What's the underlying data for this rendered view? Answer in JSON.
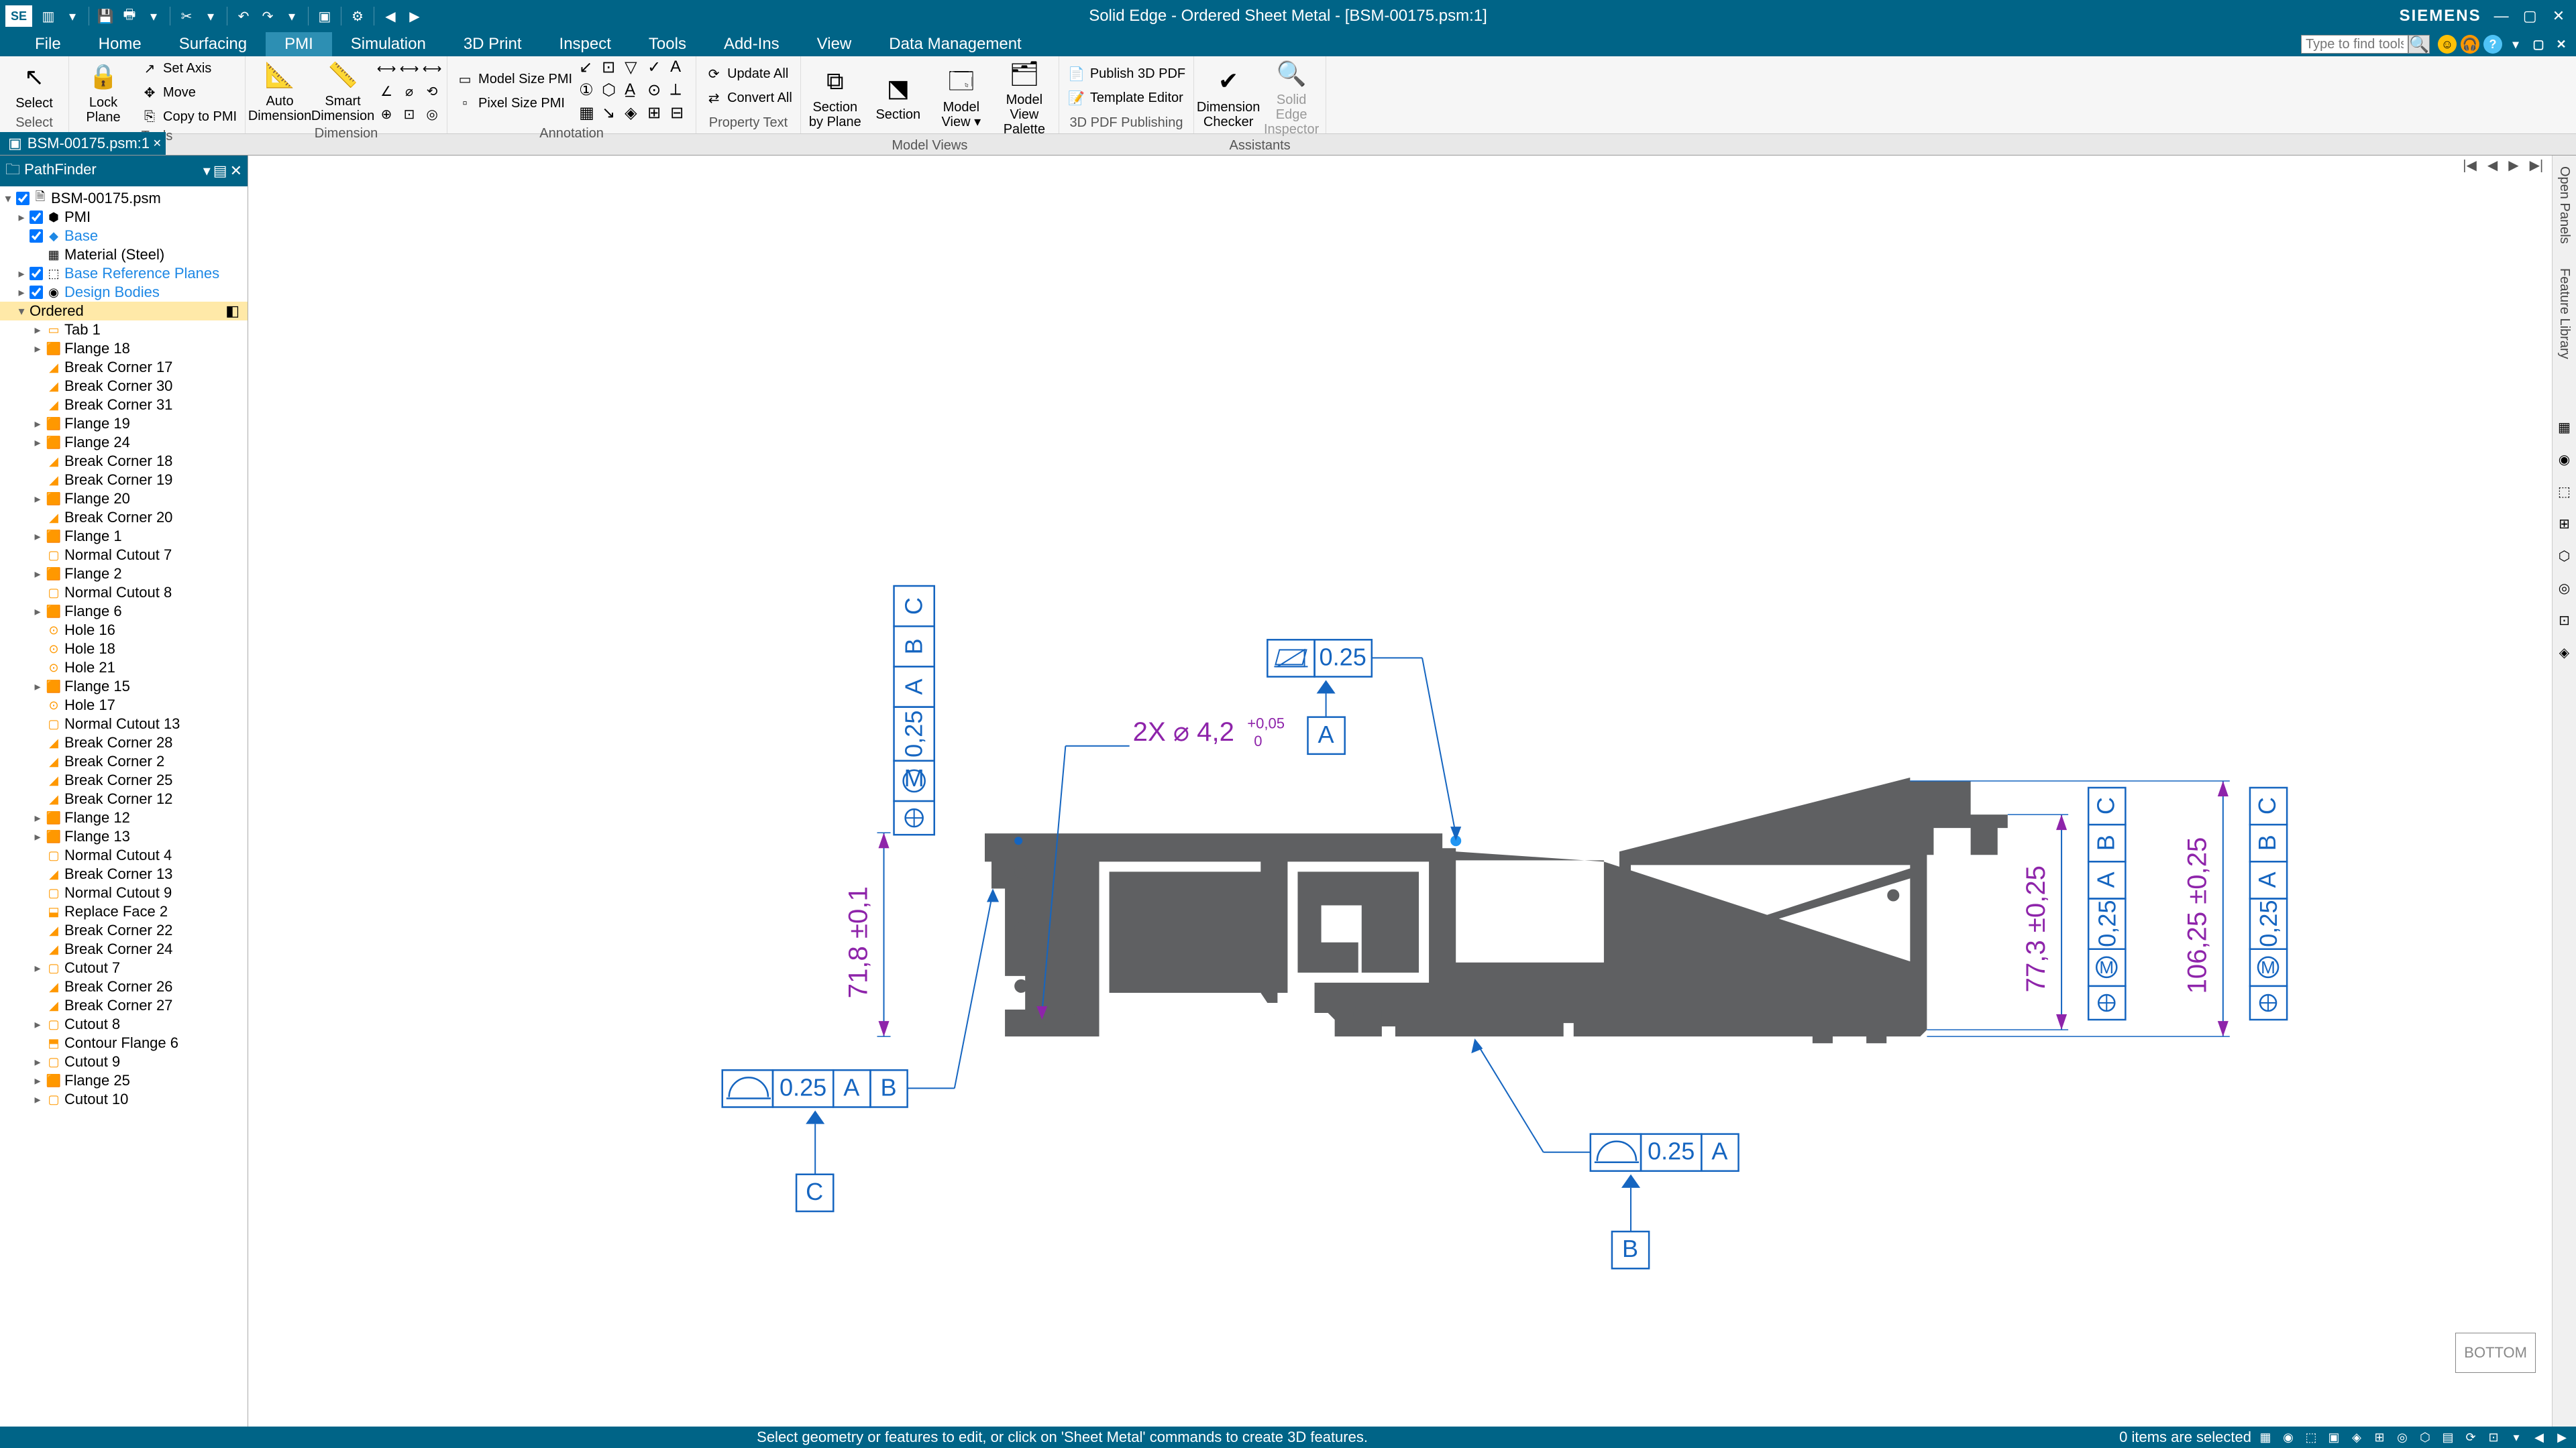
{
  "app": {
    "logo": "SE",
    "title": "Solid Edge - Ordered Sheet Metal - [BSM-00175.psm:1]",
    "brand": "SIEMENS"
  },
  "tabs": {
    "items": [
      "File",
      "Home",
      "Surfacing",
      "PMI",
      "Simulation",
      "3D Print",
      "Inspect",
      "Tools",
      "Add-Ins",
      "View",
      "Data Management"
    ],
    "active": "PMI",
    "search_placeholder": "Type to find tools"
  },
  "ribbon": {
    "select": {
      "big": "Select",
      "label": "Select"
    },
    "tools": {
      "lock": "Lock Plane",
      "set_axis": "Set Axis",
      "move": "Move",
      "copy": "Copy to PMI",
      "label": "Tools"
    },
    "dimension": {
      "auto": "Auto Dimension",
      "smart": "Smart Dimension",
      "label": "Dimension"
    },
    "annotation": {
      "model_size": "Model Size PMI",
      "pixel_size": "Pixel Size PMI",
      "label": "Annotation"
    },
    "property": {
      "label": "Property Text"
    },
    "update": {
      "all": "Update All",
      "convert": "Convert All"
    },
    "modelviews": {
      "section_plane": "Section by Plane",
      "section": "Section",
      "model_view": "Model View ▾",
      "palette": "Model View Palette",
      "label": "Model Views"
    },
    "pdf": {
      "publish": "Publish 3D PDF",
      "template": "Template Editor",
      "label": "3D PDF Publishing"
    },
    "assistants": {
      "checker": "Dimension Checker",
      "inspector": "Solid Edge Inspector",
      "label": "Assistants"
    }
  },
  "doc_tab": {
    "name": "BSM-00175.psm:1"
  },
  "pathfinder": {
    "title": "PathFinder",
    "root": "BSM-00175.psm",
    "pmi": "PMI",
    "base": "Base",
    "material": "Material (Steel)",
    "ref_planes": "Base Reference Planes",
    "design_bodies": "Design Bodies",
    "ordered": "Ordered",
    "features": [
      "Tab 1",
      "Flange 18",
      "Break Corner 17",
      "Break Corner 30",
      "Break Corner 31",
      "Flange 19",
      "Flange 24",
      "Break Corner 18",
      "Break Corner 19",
      "Flange 20",
      "Break Corner 20",
      "Flange 1",
      "Normal Cutout 7",
      "Flange 2",
      "Normal Cutout 8",
      "Flange 6",
      "Hole 16",
      "Hole 18",
      "Hole 21",
      "Flange 15",
      "Hole 17",
      "Normal Cutout 13",
      "Break Corner 28",
      "Break Corner 2",
      "Break Corner 25",
      "Break Corner 12",
      "Flange 12",
      "Flange 13",
      "Normal Cutout 4",
      "Break Corner 13",
      "Normal Cutout 9",
      "Replace Face 2",
      "Break Corner 22",
      "Break Corner 24",
      "Cutout 7",
      "Break Corner 26",
      "Break Corner 27",
      "Cutout 8",
      "Contour Flange 6",
      "Cutout 9",
      "Flange 25",
      "Cutout 10"
    ]
  },
  "pmi": {
    "hole_callout": "2X ⌀ 4,2",
    "hole_tol_up": "+0,05",
    "hole_tol_low": "0",
    "dim_left": "71,8 ±0,1",
    "fcf_left_val": "0,25",
    "fcf_top_val": "0.25",
    "fcf_bl_val": "0.25",
    "fcf_bl_a": "A",
    "fcf_bl_b": "B",
    "fcf_br_val": "0.25",
    "fcf_br_a": "A",
    "dim_r1": "77,3 ±0,25",
    "fcf_r1_val": "0,25",
    "dim_r2": "106,25 ±0,25",
    "fcf_r2_val": "0,25",
    "datum_a": "A",
    "datum_b": "B",
    "datum_c": "C",
    "stack_a": "A",
    "stack_b": "B",
    "stack_c": "C"
  },
  "view_label": "BOTTOM",
  "right_rail": {
    "t1": "Open Panels",
    "t2": "Feature Library"
  },
  "status": {
    "prompt": "Select geometry or features to edit, or click on 'Sheet Metal' commands to create 3D features.",
    "selection": "0 items are selected"
  }
}
